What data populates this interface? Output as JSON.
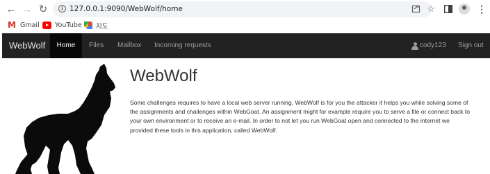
{
  "browser": {
    "url": "127.0.0.1:9090/WebWolf/home",
    "bookmarks": [
      {
        "label": "Gmail",
        "icon": "gmail-icon"
      },
      {
        "label": "YouTube",
        "icon": "youtube-icon"
      },
      {
        "label": "지도",
        "icon": "maps-icon"
      }
    ]
  },
  "navbar": {
    "brand": "WebWolf",
    "items": [
      {
        "label": "Home",
        "active": true
      },
      {
        "label": "Files",
        "active": false
      },
      {
        "label": "Mailbox",
        "active": false
      },
      {
        "label": "Incoming requests",
        "active": false
      }
    ],
    "user": "cody123",
    "signout": "Sign out"
  },
  "main": {
    "title": "WebWolf",
    "description": "Some challenges requires to have a local web server running. WebWolf is for you the attacker it helps you while solving some of the assignments and challenges within WebGoat. An assignment might for example require you to serve a file or connect back to your own environment or to receive an e-mail. In order to not let you run WebGoat open and connected to the internet we provided these tools in this application, called WebWolf."
  },
  "colors": {
    "navbar_bg": "#222222",
    "navbar_active_bg": "#080808",
    "navbar_text": "#9d9d9d"
  }
}
